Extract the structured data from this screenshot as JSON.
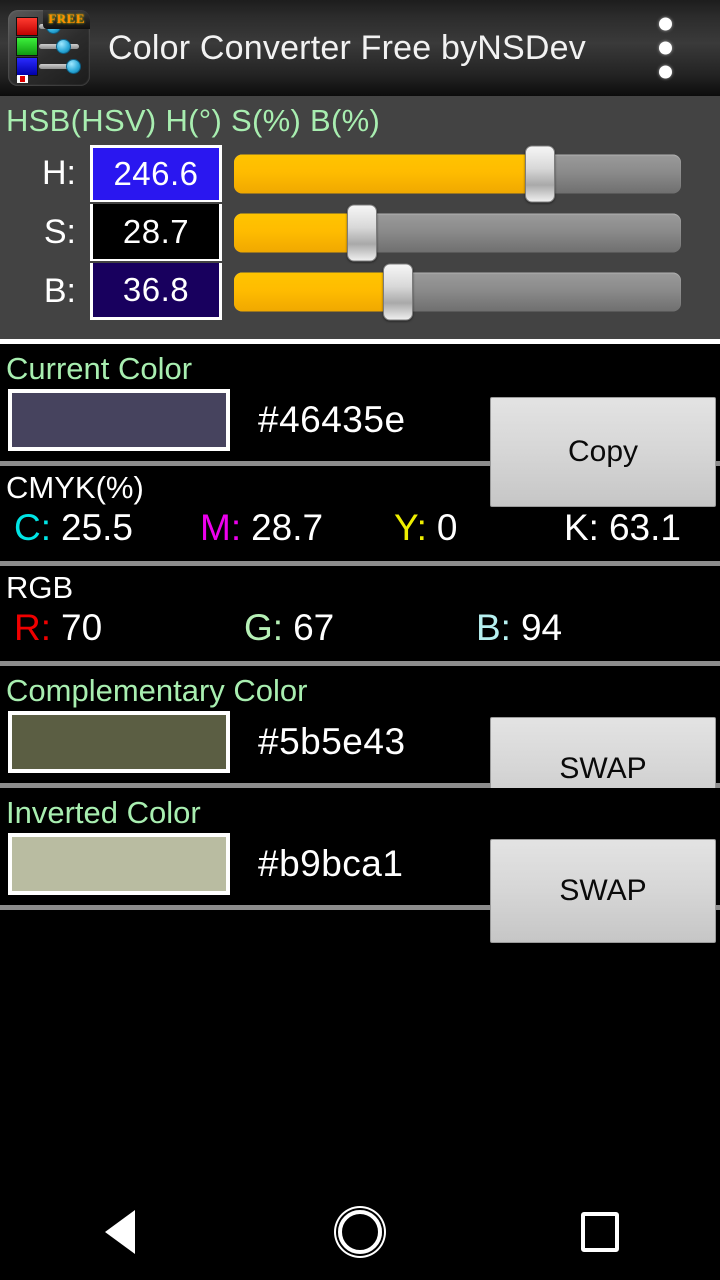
{
  "app": {
    "title": "Color Converter Free byNSDev",
    "icon_badge": "FREE",
    "overflow_menu": "overflow-menu"
  },
  "hsb": {
    "header": "HSB(HSV) H(°) S(%) B(%)",
    "rows": [
      {
        "label": "H:",
        "value": "246.6",
        "field_bg": "#2a17f0",
        "percent": 68.5
      },
      {
        "label": "S:",
        "value": "28.7",
        "field_bg": "#000000",
        "percent": 28.7
      },
      {
        "label": "B:",
        "value": "36.8",
        "field_bg": "#18005e",
        "percent": 36.8
      }
    ]
  },
  "current": {
    "title": "Current Color",
    "hex": "#46435e",
    "swatch": "#46435e",
    "button": "Copy"
  },
  "cmyk": {
    "title": "CMYK(%)",
    "items": [
      {
        "key": "C:",
        "value": "25.5"
      },
      {
        "key": "M:",
        "value": "28.7"
      },
      {
        "key": "Y:",
        "value": "0"
      },
      {
        "key": "K:",
        "value": "63.1"
      }
    ]
  },
  "rgb": {
    "title": "RGB",
    "items": [
      {
        "key": "R:",
        "value": "70"
      },
      {
        "key": "G:",
        "value": "67"
      },
      {
        "key": "B:",
        "value": "94"
      }
    ]
  },
  "complementary": {
    "title": "Complementary Color",
    "hex": "#5b5e43",
    "swatch": "#5b5e43",
    "button": "SWAP"
  },
  "inverted": {
    "title": "Inverted Color",
    "hex": "#b9bca1",
    "swatch": "#b9bca1",
    "button": "SWAP"
  },
  "navbar": {
    "back": "back-icon",
    "home": "home-icon",
    "recents": "recents-icon"
  },
  "colors": {
    "accent_green": "#a8eeb0",
    "slider_fill": "#ffbc00",
    "panel_bg": "#434343"
  }
}
